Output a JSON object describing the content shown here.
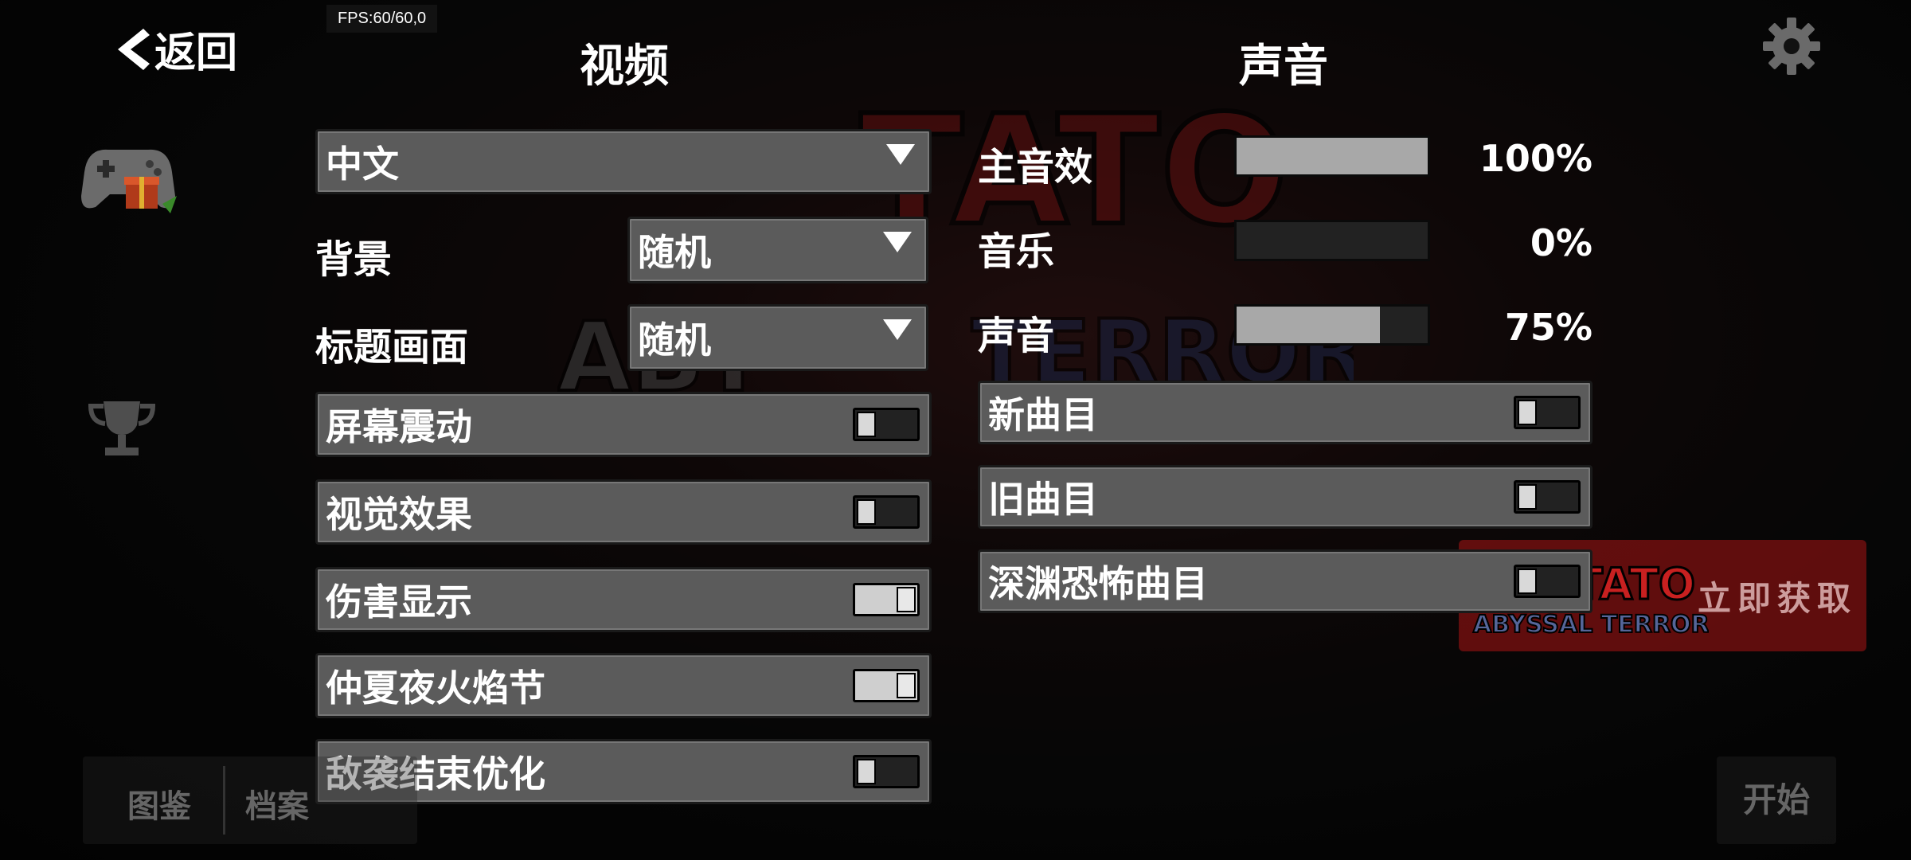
{
  "header": {
    "back_label": "返回",
    "fps_text": "FPS:60/60,0"
  },
  "video": {
    "title": "视频",
    "language_value": "中文",
    "background_label": "背景",
    "background_value": "随机",
    "title_screen_label": "标题画面",
    "title_screen_value": "随机",
    "toggles": [
      {
        "label": "屏幕震动",
        "on": false
      },
      {
        "label": "视觉效果",
        "on": false
      },
      {
        "label": "伤害显示",
        "on": true
      },
      {
        "label": "仲夏夜火焰节",
        "on": true
      },
      {
        "label": "敌袭结束优化",
        "on": false
      }
    ]
  },
  "audio": {
    "title": "声音",
    "sliders": [
      {
        "label": "主音效",
        "percent_text": "100%",
        "value": 1.0
      },
      {
        "label": "音乐",
        "percent_text": "0%",
        "value": 0.0
      },
      {
        "label": "声音",
        "percent_text": "75%",
        "value": 0.75
      }
    ],
    "toggles": [
      {
        "label": "新曲目",
        "on": false
      },
      {
        "label": "旧曲目",
        "on": false
      },
      {
        "label": "深渊恐怖曲目",
        "on": false
      }
    ]
  },
  "promo": {
    "logo_text_top": "TATO",
    "logo_text_bottom": "ABYSSAL TERRORS",
    "cta": "立即获取"
  },
  "background_art": {
    "logo_top": "TATO",
    "logo_bottom": "TERRORS",
    "logo_left": "ABY"
  },
  "bottom": {
    "tab_codex": "图鉴",
    "tab_archive": "档案",
    "start_label": "开始"
  },
  "colors": {
    "panel": "#5b5b5b",
    "slider_fill": "#a8a8a8",
    "promo_red": "#aa1414"
  }
}
